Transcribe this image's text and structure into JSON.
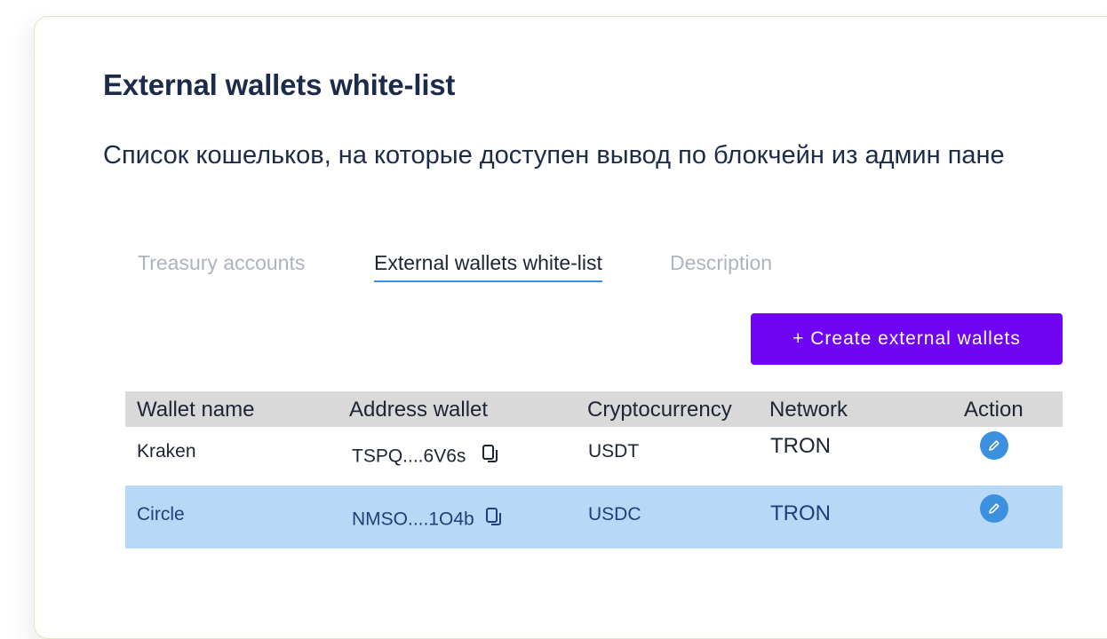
{
  "page": {
    "title": "External wallets white-list",
    "subtitle": "Список кошельков, на которые доступен вывод по блокчейн из админ пане"
  },
  "tabs": [
    {
      "label": "Treasury accounts",
      "active": false
    },
    {
      "label": "External wallets white-list",
      "active": true
    },
    {
      "label": "Description",
      "active": false
    }
  ],
  "toolbar": {
    "create_label": "+ Create external wallets"
  },
  "table": {
    "columns": [
      "Wallet name",
      "Address wallet",
      "Cryptocurrency",
      "Network",
      "Action"
    ],
    "rows": [
      {
        "wallet_name": "Kraken",
        "address": "TSPQ....6V6s",
        "crypto": "USDT",
        "network": "TRON",
        "selected": false
      },
      {
        "wallet_name": "Circle",
        "address": "NMSO....1O4b",
        "crypto": "USDC",
        "network": "TRON",
        "selected": true
      }
    ]
  },
  "icons": {
    "copy": "copy-icon",
    "edit": "pencil-icon"
  },
  "colors": {
    "title": "#1d2b4a",
    "accent_button": "#6f05f3",
    "active_tab_underline": "#3b91e0",
    "selected_row": "#b8d9f6",
    "table_header": "#d9d9d9",
    "edit_icon": "#3b91e0"
  }
}
